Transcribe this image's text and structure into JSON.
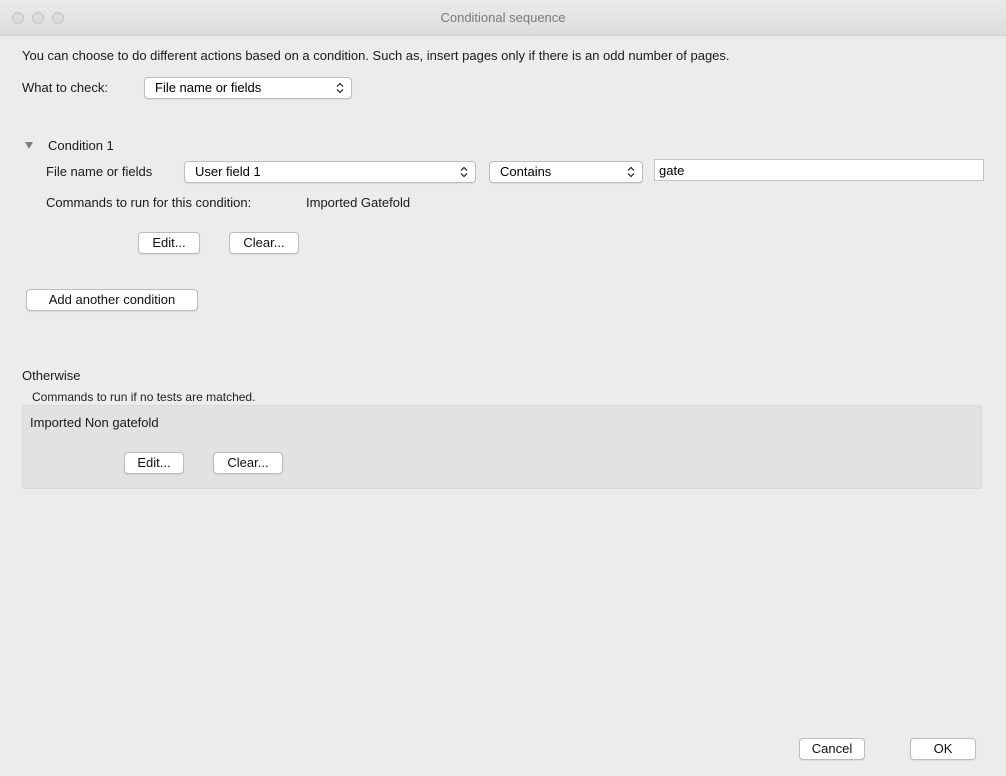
{
  "window": {
    "title": "Conditional sequence"
  },
  "intro_text": "You can choose to do different actions based on a condition. Such as, insert pages only if there is an odd number of pages.",
  "what_to_check": {
    "label": "What to check:",
    "selected": "File name or fields"
  },
  "condition1": {
    "title": "Condition 1",
    "field_label": "File name or fields",
    "field_selected": "User field 1",
    "operator_selected": "Contains",
    "value": "gate",
    "commands_label": "Commands to run for this condition:",
    "commands_value": "Imported Gatefold",
    "edit_label": "Edit...",
    "clear_label": "Clear..."
  },
  "add_condition_label": "Add another condition",
  "otherwise": {
    "title": "Otherwise",
    "subtitle": "Commands to run if no tests are matched.",
    "commands_value": "Imported Non gatefold",
    "edit_label": "Edit...",
    "clear_label": "Clear..."
  },
  "footer": {
    "cancel_label": "Cancel",
    "ok_label": "OK"
  },
  "icons": {
    "popup_arrows": "up-down-chevron-icon",
    "disclosure": "disclosure-triangle-icon"
  }
}
